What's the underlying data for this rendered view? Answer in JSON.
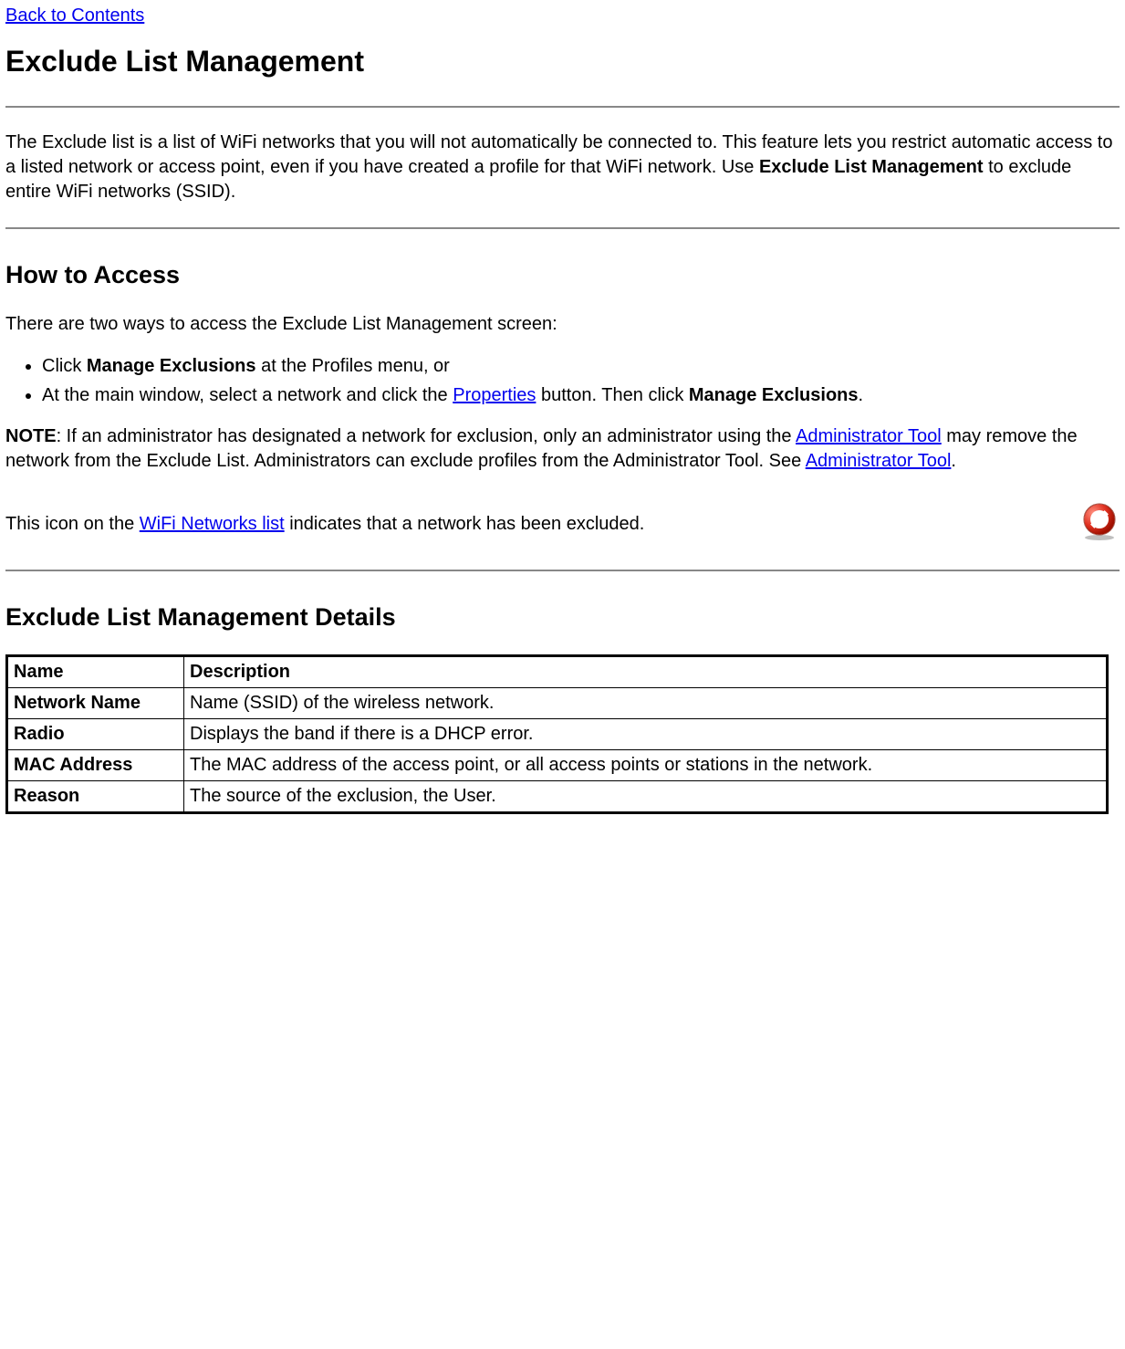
{
  "nav": {
    "back_link": "Back to Contents"
  },
  "title": "Exclude List Management",
  "intro": {
    "part1": "The Exclude list is a list of WiFi networks that you will not automatically be connected to. This feature lets you restrict automatic access to a listed network or access point, even if you have created a profile for that WiFi network. Use ",
    "bold1": "Exclude List Management",
    "part2": " to exclude entire WiFi networks (SSID)."
  },
  "how_to_access": {
    "heading": "How to Access",
    "intro": "There are two ways to access the Exclude List Management screen:",
    "bullet1_pre": "Click ",
    "bullet1_bold": "Manage Exclusions",
    "bullet1_post": " at the Profiles menu, or",
    "bullet2_pre": "At the main window, select a network and click the ",
    "bullet2_link": "Properties",
    "bullet2_mid": " button. Then click ",
    "bullet2_bold": "Manage Exclusions",
    "bullet2_post": "."
  },
  "note": {
    "label": "NOTE",
    "part1": ": If an administrator has designated a network for exclusion, only an administrator using the ",
    "link1": "Administrator Tool",
    "part2": " may remove the network from the Exclude List. Administrators can exclude profiles from the Administrator Tool. See ",
    "link2": "Administrator Tool",
    "part3": "."
  },
  "icon_line": {
    "pre": "This icon on the ",
    "link": "WiFi Networks list",
    "post": " indicates that a network has been excluded."
  },
  "details": {
    "heading": "Exclude List Management Details",
    "headers": {
      "name": "Name",
      "desc": "Description"
    },
    "rows": [
      {
        "name": "Network Name",
        "desc": "Name (SSID) of the wireless network."
      },
      {
        "name": "Radio",
        "desc": "Displays the band if there is a DHCP error."
      },
      {
        "name": "MAC Address",
        "desc": "The MAC address of the access point, or all access points or stations in the network."
      },
      {
        "name": "Reason",
        "desc": "The source of the exclusion, the User."
      }
    ]
  }
}
